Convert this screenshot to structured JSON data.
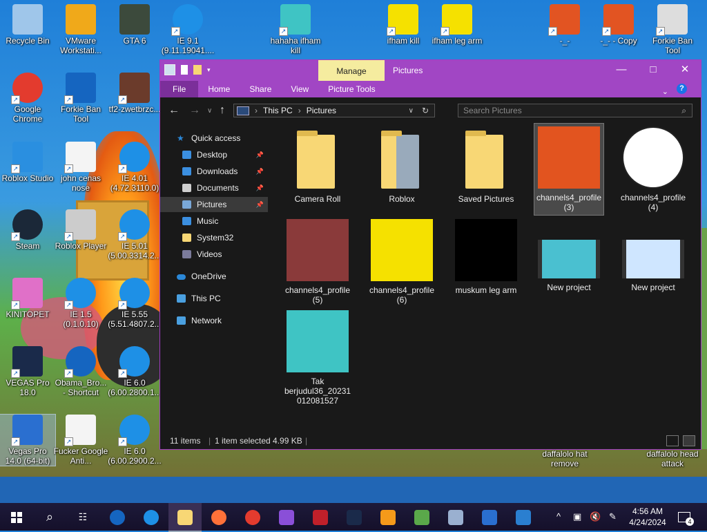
{
  "desktop_icons": [
    {
      "label": "Recycle Bin",
      "icon": "recycle-bin-icon",
      "color": "#9fc6ea"
    },
    {
      "label": "VMware Workstati...",
      "icon": "vmware-icon",
      "color": "#f0a91a"
    },
    {
      "label": "GTA 6",
      "icon": "gta6-icon",
      "color": "#3c4a3c"
    },
    {
      "label": "IE 9.1 (9.11.19041....",
      "icon": "ie-icon",
      "color": "#1e90e6"
    },
    {
      "label": "hahaha ifham kill",
      "icon": "avatar-image-icon",
      "color": "#3fc4c4"
    },
    {
      "label": "ifham kill",
      "icon": "yellow-figure-icon",
      "color": "#f5e100"
    },
    {
      "label": "ifham leg arm",
      "icon": "yellow-figure-icon",
      "color": "#f5e100"
    },
    {
      "label": "-_-",
      "icon": "red-character-icon",
      "color": "#e25422"
    },
    {
      "label": "-_- - Copy",
      "icon": "red-character-icon",
      "color": "#e25422"
    },
    {
      "label": "Forkie Ban Tool",
      "icon": "settings-app-icon",
      "color": "#dddddd"
    },
    {
      "label": "Google Chrome",
      "icon": "chrome-icon",
      "color": "#e33b2e"
    },
    {
      "label": "Forkie Ban Tool",
      "icon": "question-icon",
      "color": "#1565c0"
    },
    {
      "label": "tf2-zwetbrzc...",
      "icon": "tf2-image-icon",
      "color": "#6b3b2b"
    },
    {
      "label": "Roblox Studio",
      "icon": "roblox-studio-icon",
      "color": "#2a8fe0"
    },
    {
      "label": "john cenas nose",
      "icon": "document-icon",
      "color": "#f4f4f4"
    },
    {
      "label": "IE 4.01 (4.72.3110.0)",
      "icon": "ie-icon",
      "color": "#1e90e6"
    },
    {
      "label": "Steam",
      "icon": "steam-icon",
      "color": "#1b2838"
    },
    {
      "label": "Roblox Player",
      "icon": "roblox-player-icon",
      "color": "#cccccc"
    },
    {
      "label": "IE 5.01 (5.00.3314.2...",
      "icon": "ie-icon",
      "color": "#1e90e6"
    },
    {
      "label": "KINITOPET",
      "icon": "kinitopet-icon",
      "color": "#e070c8"
    },
    {
      "label": "IE 1.5 (0.1.0.10)",
      "icon": "ie-globe-icon",
      "color": "#1e90e6"
    },
    {
      "label": "IE 5.55 (5.51.4807.2...",
      "icon": "ie-icon",
      "color": "#1e90e6"
    },
    {
      "label": "VEGAS Pro 18.0",
      "icon": "vegas-pro-icon",
      "color": "#1a2a4a"
    },
    {
      "label": "Obama_Bro... - Shortcut",
      "icon": "obama-logo-icon",
      "color": "#1565c0"
    },
    {
      "label": "IE 6.0 (6.00.2800.1...",
      "icon": "ie-icon",
      "color": "#1e90e6"
    },
    {
      "label": "Vegas Pro 14.0 (64-bit)",
      "icon": "vegas-pro-icon",
      "color": "#2a6fd0"
    },
    {
      "label": "Fucker Google Anti...",
      "icon": "document-icon",
      "color": "#f4f4f4"
    },
    {
      "label": "IE 6.0 (6.00.2900.2...",
      "icon": "ie-icon",
      "color": "#1e90e6"
    },
    {
      "label": "daffalolo hat remove",
      "icon": "none",
      "color": "#000000"
    },
    {
      "label": "daffalolo head attack",
      "icon": "none",
      "color": "#000000"
    }
  ],
  "explorer": {
    "title": "Pictures",
    "manage_tab": "Manage",
    "ribbon_tabs": [
      "File",
      "Home",
      "Share",
      "View",
      "Picture Tools"
    ],
    "breadcrumb": [
      "This PC",
      "Pictures"
    ],
    "search_placeholder": "Search Pictures",
    "sidebar": [
      {
        "label": "Quick access",
        "icon": "star-icon",
        "color": "#2b88d8",
        "pinned": false
      },
      {
        "label": "Desktop",
        "icon": "desktop-folder-icon",
        "color": "#3b8fe0",
        "pinned": true
      },
      {
        "label": "Downloads",
        "icon": "download-arrow-icon",
        "color": "#3b8fe0",
        "pinned": true
      },
      {
        "label": "Documents",
        "icon": "documents-icon",
        "color": "#cfcfcf",
        "pinned": true
      },
      {
        "label": "Pictures",
        "icon": "pictures-icon",
        "color": "#7aa8d8",
        "pinned": true
      },
      {
        "label": "Music",
        "icon": "music-note-icon",
        "color": "#3b8fe0",
        "pinned": false
      },
      {
        "label": "System32",
        "icon": "folder-icon",
        "color": "#f8d775",
        "pinned": false
      },
      {
        "label": "Videos",
        "icon": "videos-icon",
        "color": "#7a7a9a",
        "pinned": false
      },
      {
        "label": "OneDrive",
        "icon": "cloud-icon",
        "color": "#2b88d8",
        "pinned": false
      },
      {
        "label": "This PC",
        "icon": "computer-icon",
        "color": "#4aa0e0",
        "pinned": false
      },
      {
        "label": "Network",
        "icon": "network-icon",
        "color": "#4aa0e0",
        "pinned": false
      }
    ],
    "files": [
      {
        "label": "Camera Roll",
        "type": "folder",
        "color": "#f8d775"
      },
      {
        "label": "Roblox",
        "type": "folder",
        "color": "#f8d775"
      },
      {
        "label": "Saved Pictures",
        "type": "folder",
        "color": "#f8d775"
      },
      {
        "label": "channels4_profile (3)",
        "type": "image",
        "color": "#e2541f"
      },
      {
        "label": "channels4_profile (4)",
        "type": "image",
        "color": "#ffffff"
      },
      {
        "label": "channels4_profile (5)",
        "type": "image",
        "color": "#8a3a3a"
      },
      {
        "label": "channels4_profile (6)",
        "type": "image",
        "color": "#f5e100"
      },
      {
        "label": "muskum leg arm",
        "type": "image",
        "color": "#000000"
      },
      {
        "label": "New project",
        "type": "video",
        "color": "#4ac0d0"
      },
      {
        "label": "New project",
        "type": "video",
        "color": "#cfe6ff"
      },
      {
        "label": "Tak berjudul36_20231 012081527",
        "type": "image",
        "color": "#3fc4c4"
      }
    ],
    "status_items": "11 items",
    "status_selected": "1 item selected  4.99 KB"
  },
  "taskbar": {
    "apps": [
      {
        "name": "obama-icon",
        "color": "#1565c0"
      },
      {
        "name": "ie-icon",
        "color": "#1e90e6"
      },
      {
        "name": "file-explorer-icon",
        "color": "#f8d775"
      },
      {
        "name": "firefox-icon",
        "color": "#ff7139"
      },
      {
        "name": "chrome-icon",
        "color": "#e33b2e"
      },
      {
        "name": "visual-studio-icon",
        "color": "#8a4fd8"
      },
      {
        "name": "fg-icon",
        "color": "#c0202a"
      },
      {
        "name": "vegas-icon",
        "color": "#1a2a4a"
      },
      {
        "name": "search-magnifier-icon",
        "color": "#f59a1a"
      },
      {
        "name": "chart-app-icon",
        "color": "#5aa84a"
      },
      {
        "name": "control-panel-icon",
        "color": "#9ab0d0"
      },
      {
        "name": "document-app-icon",
        "color": "#2a6fd0"
      },
      {
        "name": "media-player-icon",
        "color": "#2a7fd0"
      }
    ],
    "time": "4:56 AM",
    "date": "4/24/2024",
    "notification_count": "4"
  }
}
